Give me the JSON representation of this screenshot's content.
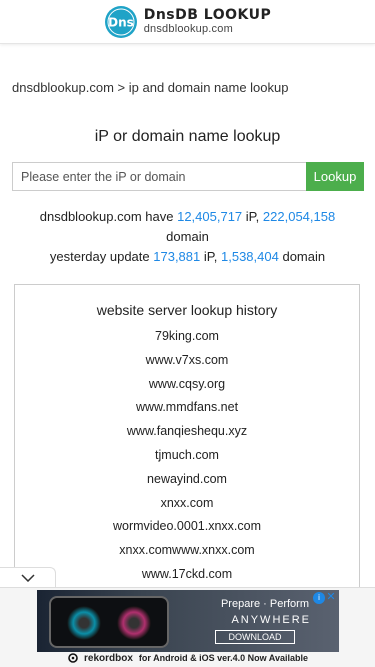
{
  "header": {
    "logo_mark": "Dns",
    "title": "DnsDB LOOKUP",
    "subtitle": "dnsdblookup.com"
  },
  "breadcrumb": {
    "home": "dnsdblookup.com",
    "separator": ">",
    "current": "ip and domain name lookup"
  },
  "page_title": "iP or domain name lookup",
  "search": {
    "placeholder": "Please enter the iP or domain",
    "value": "",
    "button_label": "Lookup"
  },
  "stats": {
    "prefix": "dnsdblookup.com have",
    "ip_count": "12,405,717",
    "ip_label": "iP,",
    "domain_count": "222,054,158",
    "domain_label": "domain",
    "yesterday_prefix": "yesterday update",
    "yesterday_ip_count": "173,881",
    "yesterday_ip_label": "iP,",
    "yesterday_domain_count": "1,538,404",
    "yesterday_domain_label": "domain"
  },
  "history": {
    "title": "website server lookup history",
    "items": [
      "79king.com",
      "www.v7xs.com",
      "www.cqsy.org",
      "www.mmdfans.net",
      "www.fanqieshequ.xyz",
      "tjmuch.com",
      "newayind.com",
      "xnxx.com",
      "wormvideo.0001.xnxx.com",
      "xnxx.comwww.xnxx.com",
      "www.17ckd.com"
    ]
  },
  "ad": {
    "headline": "Prepare · Perform",
    "subline": "ANYWHERE",
    "cta": "DOWNLOAD",
    "brand": "rekordbox",
    "tagline": "for Android & iOS ver.4.0 Now Available",
    "info_icon": "i",
    "close_icon": "✕"
  },
  "colors": {
    "link_blue": "#1e88e5",
    "button_green": "#4cae4c",
    "logo_teal": "#1fa3c7"
  }
}
